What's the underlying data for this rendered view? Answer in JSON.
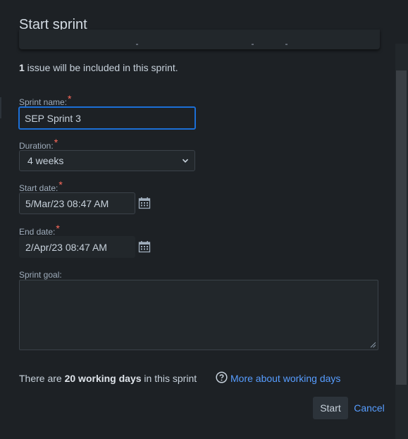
{
  "dialog": {
    "title": "Start sprint",
    "issue_count": "1",
    "issue_text": " issue will be included in this sprint."
  },
  "form": {
    "sprint_name": {
      "label": "Sprint name:",
      "required_mark": "*",
      "value": "SEP Sprint 3"
    },
    "duration": {
      "label": "Duration:",
      "required_mark": "*",
      "value": "4 weeks"
    },
    "start_date": {
      "label": "Start date:",
      "required_mark": "*",
      "value": "5/Mar/23 08:47 AM"
    },
    "end_date": {
      "label": "End date:",
      "required_mark": "*",
      "value": "2/Apr/23 08:47 AM"
    },
    "sprint_goal": {
      "label": "Sprint goal:",
      "value": ""
    }
  },
  "working_days": {
    "prefix": "There are ",
    "count_text": "20 working days",
    "suffix": " in this sprint",
    "help_link": "More about working days"
  },
  "actions": {
    "start_label": "Start",
    "cancel_label": "Cancel"
  },
  "icons": {
    "calendar": "calendar-icon",
    "help": "question-circle-icon",
    "select": "chevron-down-icon"
  },
  "colors": {
    "background": "#1d2125",
    "link": "#579dff",
    "focus_border": "#1c6fd6",
    "required": "#ff6b5b"
  }
}
